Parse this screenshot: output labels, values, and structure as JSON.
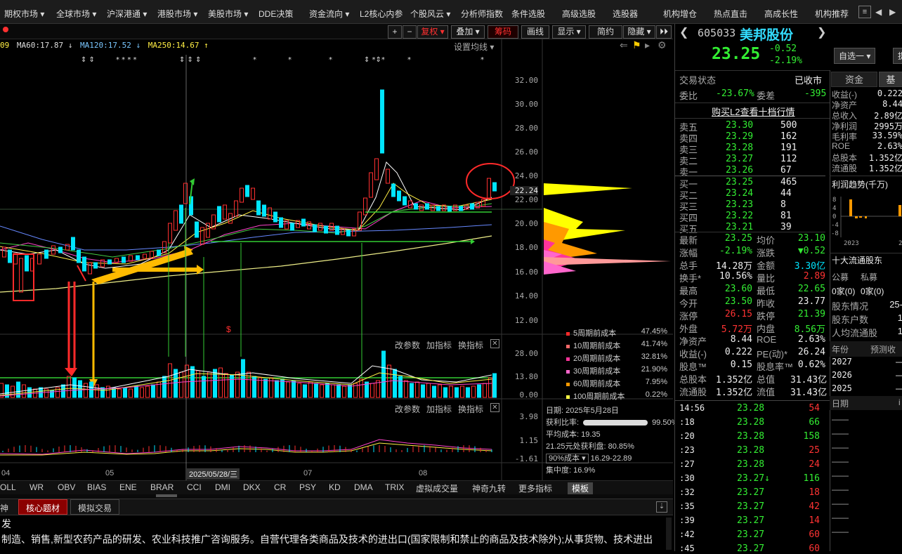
{
  "topnav": [
    "期权市场 ▾",
    "全球市场 ▾",
    "沪深港通 ▾",
    "港股市场 ▾",
    "美股市场 ▾",
    "DDE决策",
    "资金流向 ▾",
    "L2核心内参",
    "个股风云 ▾",
    "分析师指数",
    "条件选股",
    "高级选股",
    "选股器",
    "机构增仓",
    "热点直击",
    "高成长性",
    "机构推荐"
  ],
  "toolbar": {
    "plus": "+",
    "minus": "−",
    "fuquan": "复权 ▾",
    "diejia": "叠加 ▾",
    "chouma": "筹码",
    "huaxian": "画线",
    "xianshi": "显示 ▾",
    "jianyue": "简约",
    "yincang": "隐藏 ▾"
  },
  "ma": {
    "prefix": "09",
    "ma60": "MA60:17.87 ↓",
    "ma120": "MA120:17.52 ↓",
    "ma250": "MA250:14.67 ↑",
    "settings": "设置均线 ▾"
  },
  "price_axis": [
    "32.00",
    "30.00",
    "28.00",
    "26.00",
    "24.00",
    "22.24",
    "22.00",
    "20.00",
    "18.00",
    "16.00",
    "14.00",
    "12.00"
  ],
  "vol_axis": [
    "28.00",
    "13.80",
    "0.00"
  ],
  "ind_axis": [
    "3.98",
    "1.15",
    "-1.61"
  ],
  "panel_btns": [
    "改参数",
    "加指标",
    "换指标"
  ],
  "date_axis": {
    "d04": "04",
    "d05": "05",
    "sel": "2025/05/28/三",
    "d07": "07",
    "d08": "08"
  },
  "cost_dist": [
    {
      "label": "5周期前成本",
      "value": "47.45%",
      "color": "#ff2a2a"
    },
    {
      "label": "10周期前成本",
      "value": "41.74%",
      "color": "#ff6a6a"
    },
    {
      "label": "20周期前成本",
      "value": "32.81%",
      "color": "#ff3399"
    },
    {
      "label": "30周期前成本",
      "value": "21.90%",
      "color": "#ff66cc"
    },
    {
      "label": "60周期前成本",
      "value": "7.95%",
      "color": "#ff9900"
    },
    {
      "label": "100周期前成本",
      "value": "0.22%",
      "color": "#ffff44"
    }
  ],
  "chip_info": {
    "date": "日期: 2025年5月28日",
    "profit_label": "获利比率:",
    "profit_value": "99.50%",
    "avg_cost": "平均成本: 19.35",
    "profit_at": "21.25元处获利盘: 80.85%",
    "range_sel": "90%成本 ▾",
    "range": "16.29-22.89",
    "concentration": "集中度: 16.9%"
  },
  "bottom_tabs": [
    "OLL",
    "WR",
    "OBV",
    "BIAS",
    "ENE",
    "BRAR",
    "CCI",
    "DMI",
    "DKX",
    "CR",
    "PSY",
    "KD",
    "DMA",
    "TRIX",
    "虚拟成交量",
    "神奇九转",
    "更多指标",
    "模板"
  ],
  "info_tabs": [
    "神",
    "核心题材",
    "模拟交易"
  ],
  "desc": {
    "line1": "发",
    "line2": "制造、销售,新型农药产品的研发、农业科技推广咨询服务。自营代理各类商品及技术的进出口(国家限制和禁止的商品及技术除外);从事货物、技术进出"
  },
  "stock": {
    "code": "605033",
    "name": "美邦股份",
    "price": "23.25",
    "change": "-0.52",
    "pct": "-2.19%",
    "btn_zixuan": "自选一 ▾",
    "btn_ti": "提"
  },
  "trade_status": {
    "label": "交易状态",
    "value": "已收市"
  },
  "weibi": {
    "l1": "委比",
    "v1": "-23.67%",
    "l2": "委差",
    "v2": "-395"
  },
  "l2link": "购买L2查看十档行情",
  "sell": [
    {
      "n": "卖五",
      "p": "23.30",
      "v": "500"
    },
    {
      "n": "卖四",
      "p": "23.29",
      "v": "162"
    },
    {
      "n": "卖三",
      "p": "23.28",
      "v": "191"
    },
    {
      "n": "卖二",
      "p": "23.27",
      "v": "112"
    },
    {
      "n": "卖一",
      "p": "23.26",
      "v": "67"
    }
  ],
  "buy": [
    {
      "n": "买一",
      "p": "23.25",
      "v": "465"
    },
    {
      "n": "买二",
      "p": "23.24",
      "v": "44"
    },
    {
      "n": "买三",
      "p": "23.23",
      "v": "8"
    },
    {
      "n": "买四",
      "p": "23.22",
      "v": "81"
    },
    {
      "n": "买五",
      "p": "23.21",
      "v": "39"
    }
  ],
  "stats": [
    {
      "l1": "最新",
      "v1": "23.25",
      "c1": "dn",
      "l2": "均价",
      "v2": "23.10",
      "c2": "dn"
    },
    {
      "l1": "涨幅",
      "v1": "-2.19%",
      "c1": "dn",
      "l2": "涨跌",
      "v2": "▼0.52",
      "c2": "dn"
    },
    {
      "l1": "总手",
      "v1": "14.28万",
      "c1": "wh",
      "l2": "金额",
      "v2": "3.30亿",
      "c2": "cy"
    },
    {
      "l1": "换手*",
      "v1": "10.56%",
      "c1": "wh",
      "l2": "量比",
      "v2": "2.89",
      "c2": "up"
    },
    {
      "l1": "最高",
      "v1": "23.60",
      "c1": "dn",
      "l2": "最低",
      "v2": "22.65",
      "c2": "dn"
    },
    {
      "l1": "今开",
      "v1": "23.50",
      "c1": "dn",
      "l2": "昨收",
      "v2": "23.77",
      "c2": "wh"
    },
    {
      "l1": "涨停",
      "v1": "26.15",
      "c1": "up",
      "l2": "跌停",
      "v2": "21.39",
      "c2": "dn"
    },
    {
      "l1": "外盘",
      "v1": "5.72万",
      "c1": "up",
      "l2": "内盘",
      "v2": "8.56万",
      "c2": "dn"
    },
    {
      "l1": "净资产",
      "v1": "8.44",
      "c1": "wh",
      "l2": "ROE",
      "v2": "2.63%",
      "c2": "wh"
    },
    {
      "l1": "收益(-)",
      "v1": "0.222",
      "c1": "wh",
      "l2": "PE(动)*",
      "v2": "26.24",
      "c2": "wh"
    },
    {
      "l1": "股息™",
      "v1": "0.15",
      "c1": "wh",
      "l2": "股息率™",
      "v2": "0.62%",
      "c2": "wh"
    },
    {
      "l1": "总股本",
      "v1": "1.352亿",
      "c1": "wh",
      "l2": "总值",
      "v2": "31.43亿",
      "c2": "wh"
    },
    {
      "l1": "流通股",
      "v1": "1.352亿",
      "c1": "wh",
      "l2": "流值",
      "v2": "31.43亿",
      "c2": "wh"
    }
  ],
  "ticks": [
    {
      "t": "14:56",
      "p": "23.28",
      "v": "54",
      "c": "up"
    },
    {
      "t": ":18",
      "p": "23.28",
      "v": "66",
      "c": "dn"
    },
    {
      "t": ":20",
      "p": "23.28",
      "v": "158",
      "c": "dn"
    },
    {
      "t": ":23",
      "p": "23.28",
      "v": "25",
      "c": "up"
    },
    {
      "t": ":27",
      "p": "23.28",
      "v": "24",
      "c": "up"
    },
    {
      "t": ":30",
      "p": "23.27↓",
      "v": "116",
      "c": "dn"
    },
    {
      "t": ":32",
      "p": "23.27",
      "v": "18",
      "c": "up"
    },
    {
      "t": ":35",
      "p": "23.27",
      "v": "42",
      "c": "up"
    },
    {
      "t": ":39",
      "p": "23.27",
      "v": "14",
      "c": "up"
    },
    {
      "t": ":42",
      "p": "23.27",
      "v": "60",
      "c": "up"
    },
    {
      "t": ":45",
      "p": "23.27",
      "v": "60",
      "c": "up"
    }
  ],
  "fund_tabs": {
    "t1": "资金",
    "t2": "基"
  },
  "fund": [
    {
      "l": "收益(-)",
      "v": "0.222"
    },
    {
      "l": "净资产",
      "v": "8.44"
    },
    {
      "l": "总收入",
      "v": "2.89亿"
    },
    {
      "l": "净利润",
      "v": "2995万"
    },
    {
      "l": "毛利率",
      "v": "33.59%"
    },
    {
      "l": "ROE",
      "v": "2.63%"
    },
    {
      "l": "总股本",
      "v": "1.352亿"
    },
    {
      "l": "流通股",
      "v": "1.352亿"
    }
  ],
  "profit_trend": {
    "title": "利润趋势(千万)",
    "yticks": [
      "8",
      "4",
      "0",
      "-4",
      "-8"
    ],
    "xlabels": [
      "2023",
      "2"
    ]
  },
  "holders": {
    "title": "十大流通股东",
    "gongmu": "公募",
    "simu": "私募",
    "gongmu_v": "0家(0)",
    "simu_v": "0家(0)",
    "rows": [
      {
        "l": "股东情况",
        "v": "25-"
      },
      {
        "l": "股东户数",
        "v": "1"
      },
      {
        "l": "人均流通股",
        "v": "1"
      }
    ]
  },
  "forecast": {
    "col1": "年份",
    "col2": "预测收",
    "years": [
      "2027",
      "2026",
      "2025"
    ],
    "date_label": "日期",
    "date_col2": "i"
  }
}
